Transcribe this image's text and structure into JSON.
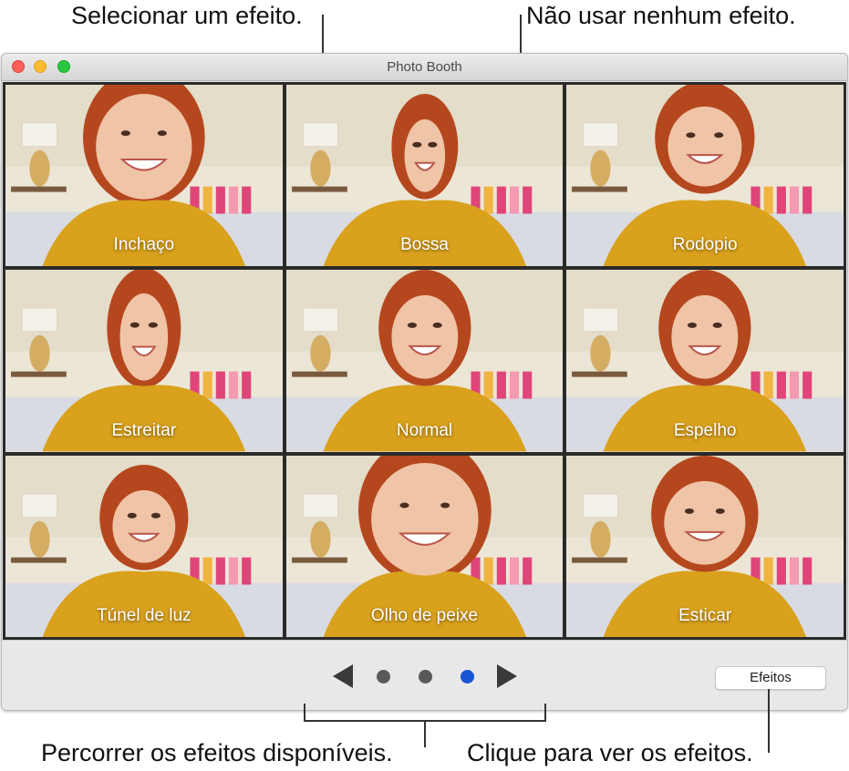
{
  "callouts": {
    "select_effect": "Selecionar um efeito.",
    "no_effect": "Não usar nenhum efeito.",
    "browse_effects": "Percorrer os efeitos disponíveis.",
    "click_to_see": "Clique para ver os efeitos."
  },
  "window": {
    "title": "Photo Booth"
  },
  "effects": [
    {
      "label": "Inchaço"
    },
    {
      "label": "Bossa"
    },
    {
      "label": "Rodopio"
    },
    {
      "label": "Estreitar"
    },
    {
      "label": "Normal"
    },
    {
      "label": "Espelho"
    },
    {
      "label": "Túnel de luz"
    },
    {
      "label": "Olho de peixe"
    },
    {
      "label": "Esticar"
    }
  ],
  "pager": {
    "pages": 3,
    "current_page": 3,
    "active_dot_color": "#1a55d6"
  },
  "bottombar": {
    "effects_button": "Efeitos"
  },
  "colors": {
    "close": "#fe5f57",
    "minimize": "#febc2e",
    "zoom": "#28c840",
    "sweater": "#d9a11c",
    "hair": "#b5471f"
  }
}
